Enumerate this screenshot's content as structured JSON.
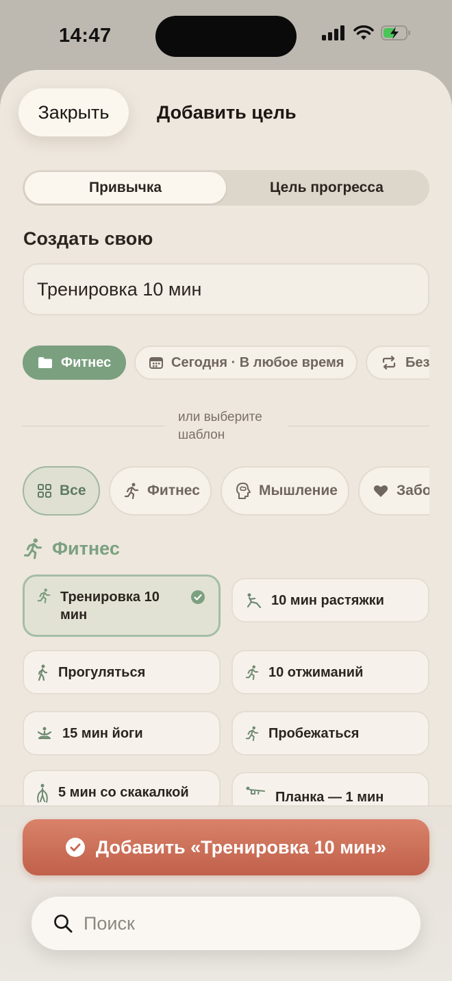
{
  "status": {
    "time": "14:47",
    "icons": [
      "signal-icon",
      "wifi-icon",
      "battery-charging-icon"
    ]
  },
  "header": {
    "close_label": "Закрыть",
    "title": "Добавить цель"
  },
  "segmented": {
    "items": [
      "Привычка",
      "Цель прогресса"
    ],
    "active": "Привычка"
  },
  "create": {
    "title": "Создать свою",
    "input_value": "Тренировка 10 мин",
    "chips": [
      {
        "label": "Фитнес",
        "icon": "folder-icon"
      },
      {
        "label": "Сегодня · В любое время",
        "icon": "calendar-icon"
      },
      {
        "label": "Без",
        "icon": "repeat-icon"
      }
    ]
  },
  "divider": {
    "text": "или выберите шаблон"
  },
  "filters": [
    {
      "label": "Все",
      "icon": "grid-icon",
      "active": true
    },
    {
      "label": "Фитнес",
      "icon": "runner-icon"
    },
    {
      "label": "Мышление",
      "icon": "brain-head-icon"
    },
    {
      "label": "Забо",
      "icon": "heart-icon"
    }
  ],
  "section": {
    "title": "Фитнес",
    "icon": "runner-icon"
  },
  "templates": [
    {
      "label": "Тренировка 10 мин",
      "icon": "workout-icon",
      "selected": true
    },
    {
      "label": "10 мин растяжки",
      "icon": "stretch-icon"
    },
    {
      "label": "Прогуляться",
      "icon": "walk-icon"
    },
    {
      "label": "10 отжиманий",
      "icon": "pushup-icon"
    },
    {
      "label": "15 мин йоги",
      "icon": "yoga-icon"
    },
    {
      "label": "Пробежаться",
      "icon": "run-icon"
    },
    {
      "label": "5 мин со скакалкой",
      "icon": "jump-rope-icon"
    },
    {
      "label": "Планка — 1 мин",
      "icon": "plank-icon"
    }
  ],
  "add_button": {
    "label": "Добавить «Тренировка 10 мин»"
  },
  "search": {
    "placeholder": "Поиск"
  },
  "colors": {
    "accent_green": "#7ba07f",
    "add_button": "#c96a52",
    "background": "#ede7de"
  }
}
